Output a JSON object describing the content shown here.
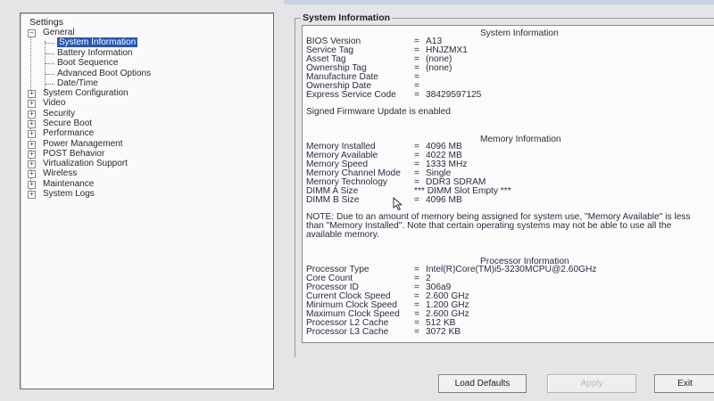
{
  "tree": {
    "root": "Settings",
    "general": {
      "label": "General",
      "children": [
        "System Information",
        "Battery Information",
        "Boot Sequence",
        "Advanced Boot Options",
        "Date/Time"
      ]
    },
    "others": [
      "System Configuration",
      "Video",
      "Security",
      "Secure Boot",
      "Performance",
      "Power Management",
      "POST Behavior",
      "Virtualization Support",
      "Wireless",
      "Maintenance",
      "System Logs"
    ],
    "collapsed_sign": "+",
    "expanded_sign": "−"
  },
  "panel": {
    "group_title": "System Information",
    "system": {
      "title": "System Information",
      "rows": [
        {
          "key": "BIOS Version",
          "value": "A13"
        },
        {
          "key": "Service Tag",
          "value": "HNJZMX1"
        },
        {
          "key": "Asset Tag",
          "value": "(none)"
        },
        {
          "key": "Ownership Tag",
          "value": "(none)"
        },
        {
          "key": "Manufacture Date",
          "value": ""
        },
        {
          "key": "Ownership Date",
          "value": ""
        },
        {
          "key": "Express Service Code",
          "value": "38429597125"
        }
      ],
      "note": "Signed Firmware Update is enabled"
    },
    "memory": {
      "title": "Memory Information",
      "rows": [
        {
          "key": "Memory Installed",
          "value": "4096 MB"
        },
        {
          "key": "Memory Available",
          "value": "4022 MB"
        },
        {
          "key": "Memory Speed",
          "value": "1333 MHz"
        },
        {
          "key": "Memory Channel Mode",
          "value": "Single"
        },
        {
          "key": "Memory Technology",
          "value": "DDR3 SDRAM"
        },
        {
          "key": "DIMM A Size",
          "value": "*** DIMM Slot Empty ***"
        },
        {
          "key": "DIMM B Size",
          "value": "4096 MB"
        }
      ],
      "note_line1": "NOTE: Due to an amount of memory being assigned for system use, \"Memory Available\" is less",
      "note_line2": "than \"Memory Installed\". Note that certain operating systems may not be able to use all the",
      "note_line3": "available memory."
    },
    "processor": {
      "title": "Processor Information",
      "rows": [
        {
          "key": "Processor Type",
          "value": "Intel(R)Core(TM)i5-3230MCPU@2.60GHz"
        },
        {
          "key": "Core Count",
          "value": "2"
        },
        {
          "key": "Processor ID",
          "value": "306a9"
        },
        {
          "key": "Current Clock Speed",
          "value": "2.600 GHz"
        },
        {
          "key": "Minimum Clock Speed",
          "value": "1.200 GHz"
        },
        {
          "key": "Maximum Clock Speed",
          "value": "2.600 GHz"
        },
        {
          "key": "Processor L2 Cache",
          "value": "512 KB"
        },
        {
          "key": "Processor L3 Cache",
          "value": "3072 KB"
        }
      ]
    },
    "equals": "="
  },
  "buttons": {
    "load_defaults": "Load Defaults",
    "apply": "Apply",
    "exit": "Exit"
  },
  "colors": {
    "selection": "#2956b2",
    "panel_bg": "#fbfbfb",
    "screen_bg": "#e6e4e6"
  }
}
